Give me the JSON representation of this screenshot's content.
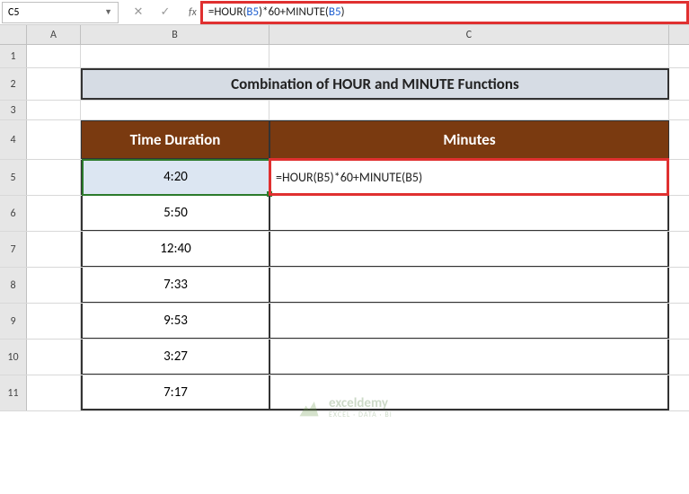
{
  "nameBox": {
    "value": "C5"
  },
  "formulaBar": {
    "fx": "fx",
    "prefix": "=HOUR(",
    "ref1": "B5",
    "mid": ")*60+MINUTE(",
    "ref2": "B5",
    "suffix": ")"
  },
  "columns": {
    "A": "A",
    "B": "B",
    "C": "C"
  },
  "rowNums": [
    "1",
    "2",
    "3",
    "4",
    "5",
    "6",
    "7",
    "8",
    "9",
    "10",
    "11"
  ],
  "title": "Combination of HOUR and MINUTE Functions",
  "headers": {
    "b": "Time Duration",
    "c": "Minutes"
  },
  "data": [
    {
      "time": "4:20",
      "formula": "=HOUR(B5)*60+MINUTE(B5)"
    },
    {
      "time": "5:50",
      "formula": ""
    },
    {
      "time": "12:40",
      "formula": ""
    },
    {
      "time": "7:33",
      "formula": ""
    },
    {
      "time": "9:53",
      "formula": ""
    },
    {
      "time": "3:27",
      "formula": ""
    },
    {
      "time": "7:17",
      "formula": ""
    }
  ],
  "watermark": {
    "name": "exceldemy",
    "sub": "EXCEL · DATA · BI"
  },
  "chart_data": {
    "type": "table",
    "title": "Combination of HOUR and MINUTE Functions",
    "columns": [
      "Time Duration",
      "Minutes"
    ],
    "rows": [
      [
        "4:20",
        "=HOUR(B5)*60+MINUTE(B5)"
      ],
      [
        "5:50",
        ""
      ],
      [
        "12:40",
        ""
      ],
      [
        "7:33",
        ""
      ],
      [
        "9:53",
        ""
      ],
      [
        "3:27",
        ""
      ],
      [
        "7:17",
        ""
      ]
    ]
  }
}
